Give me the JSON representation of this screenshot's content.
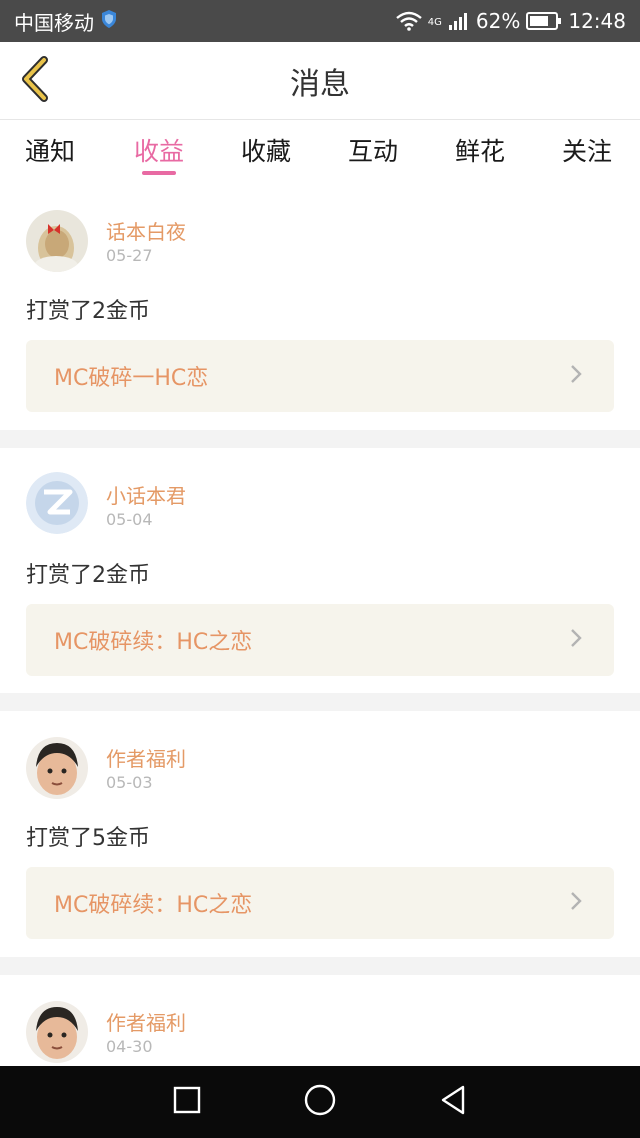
{
  "status_bar": {
    "carrier": "中国移动",
    "network": "4G",
    "battery": "62%",
    "time": "12:48"
  },
  "header": {
    "title": "消息",
    "back_icon": "back-chevron-icon"
  },
  "tabs": [
    {
      "label": "通知",
      "active": false
    },
    {
      "label": "收益",
      "active": true
    },
    {
      "label": "收藏",
      "active": false
    },
    {
      "label": "互动",
      "active": false
    },
    {
      "label": "鲜花",
      "active": false
    },
    {
      "label": "关注",
      "active": false
    }
  ],
  "items": [
    {
      "user": "话本白夜",
      "date": "05-27",
      "text": "打赏了2金币",
      "work": "MC破碎一HC恋"
    },
    {
      "user": "小话本君",
      "date": "05-04",
      "text": "打赏了2金币",
      "work": "MC破碎续：HC之恋"
    },
    {
      "user": "作者福利",
      "date": "05-03",
      "text": "打赏了5金币",
      "work": "MC破碎续：HC之恋"
    },
    {
      "user": "作者福利",
      "date": "04-30",
      "text": "",
      "work": ""
    }
  ],
  "colors": {
    "accent": "#e86aa3",
    "username": "#e49a66",
    "work_title": "#e69565",
    "work_bg": "#f6f4ec"
  }
}
